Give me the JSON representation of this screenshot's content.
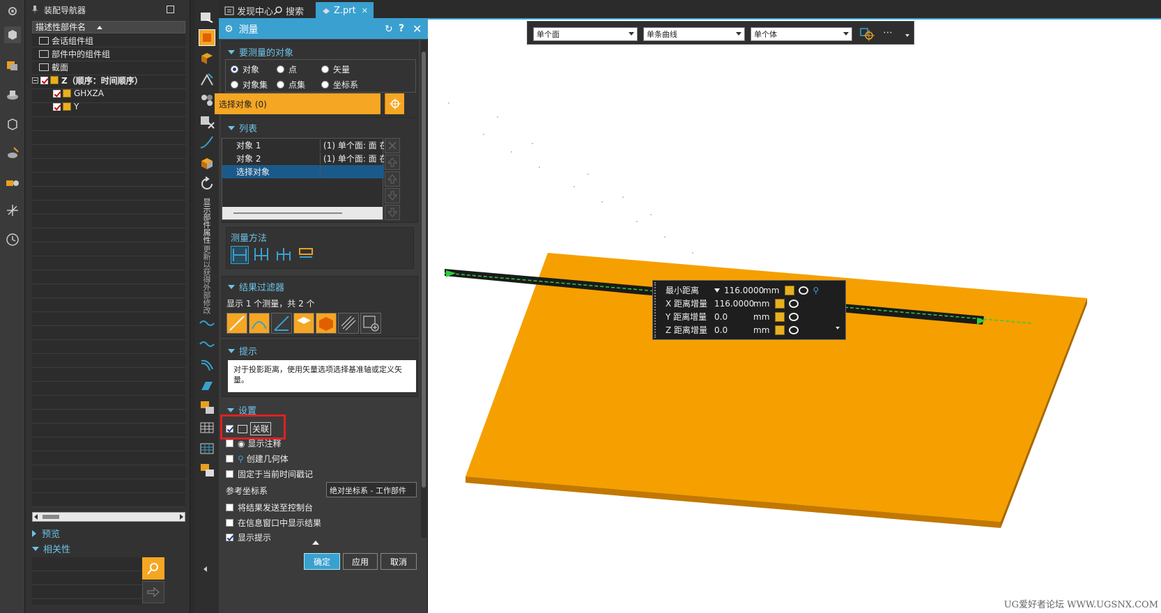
{
  "navigator": {
    "title": "装配导航器",
    "column_header": "描述性部件名",
    "tree": [
      {
        "label": "会话组件组",
        "kind": "folder"
      },
      {
        "label": "部件中的组件组",
        "kind": "folder"
      },
      {
        "label": "截面",
        "kind": "folder"
      },
      {
        "label": "Z（顺序：时间顺序）",
        "kind": "assembly"
      },
      {
        "label": "GHXZA",
        "kind": "part"
      },
      {
        "label": "Y",
        "kind": "part"
      }
    ],
    "sections": {
      "preview": "预览",
      "dependency": "相关性"
    }
  },
  "vertical_toolbar": {
    "text1": "显示部件属性",
    "text2": "更新以获得外部修改"
  },
  "tabs": [
    {
      "label": "发现中心",
      "icon": "discover-icon"
    },
    {
      "label": "搜索",
      "icon": "search-icon"
    },
    {
      "label": "Z.prt",
      "icon": "part-icon",
      "active": true
    }
  ],
  "dialog": {
    "title": "测量",
    "objects_group": "要测量的对象",
    "radios": [
      "对象",
      "点",
      "矢量",
      "对象集",
      "点集",
      "坐标系"
    ],
    "selected_radio": "对象",
    "select_objects": "选择对象 (0)",
    "list_group": "列表",
    "list_rows": [
      {
        "name": "对象 1",
        "desc": "(1) 单个面: 面 在"
      },
      {
        "name": "对象 2",
        "desc": "(1) 单个面: 面 在"
      },
      {
        "name": "选择对象",
        "desc": ""
      }
    ],
    "method_group": "测量方法",
    "filter_group": "结果过滤器",
    "filter_text": "显示 1 个测量，共 2 个",
    "hint_group": "提示",
    "hint_text": "对于投影距离，使用矢量选项选择基准轴或定义矢量。",
    "settings_group": "设置",
    "settings": [
      {
        "label": "关联",
        "checked": true
      },
      {
        "label": "显示注释",
        "checked": false
      },
      {
        "label": "创建几何体",
        "checked": false
      },
      {
        "label": "固定于当前时间戳记",
        "checked": false
      }
    ],
    "ref_csys_label": "参考坐标系",
    "ref_csys_value": "绝对坐标系 - 工作部件",
    "send_console": "将结果发送至控制台",
    "show_info": "在信息窗口中显示结果",
    "show_hint": "显示提示",
    "ok": "确定",
    "apply": "应用",
    "cancel": "取消",
    "accent": "#3aa0d0",
    "select_color": "#f5a623"
  },
  "viewport": {
    "combos": [
      "单个面",
      "单条曲线",
      "单个体"
    ],
    "readout": [
      {
        "label": "最小距离",
        "value": "116.0000",
        "unit": "mm"
      },
      {
        "label": "X 距离增量",
        "value": "116.0000",
        "unit": "mm"
      },
      {
        "label": "Y 距离增量",
        "value": "0.0",
        "unit": "mm"
      },
      {
        "label": "Z 距离增量",
        "value": "0.0",
        "unit": "mm"
      }
    ],
    "plate_color": "#f5a000",
    "watermark": "UG爱好者论坛 WWW.UGSNX.COM"
  }
}
